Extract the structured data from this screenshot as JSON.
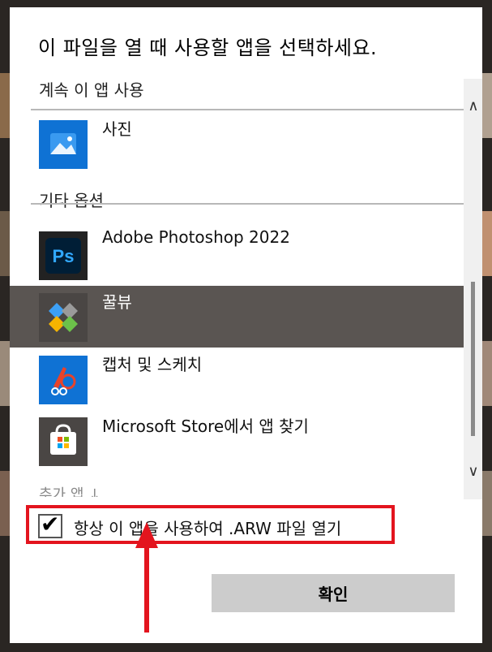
{
  "dialog": {
    "title": "이 파일을 열 때 사용할 앱을 선택하세요.",
    "keep_using_header": "계속 이 앱 사용",
    "other_options_header": "기타 옵션",
    "more_apps_label": "추가 앱 ↓",
    "always_use_label": "항상 이 앱을 사용하여 .ARW 파일 열기",
    "always_use_checked": true,
    "ok_button_label": "확인"
  },
  "apps": {
    "photos": {
      "name": "사진",
      "icon": "photos-icon"
    },
    "photoshop": {
      "name": "Adobe Photoshop 2022",
      "icon": "photoshop-icon"
    },
    "honeyview": {
      "name": "꿀뷰",
      "icon": "honeyview-icon",
      "selected": true
    },
    "snip_sketch": {
      "name": "캡처 및 스케치",
      "icon": "snip-sketch-icon"
    },
    "store": {
      "name": "Microsoft Store에서 앱 찾기",
      "icon": "store-icon"
    }
  },
  "colors": {
    "selected_bg": "#5a5552",
    "highlight": "#e3141e",
    "button_bg": "#cccccc"
  }
}
